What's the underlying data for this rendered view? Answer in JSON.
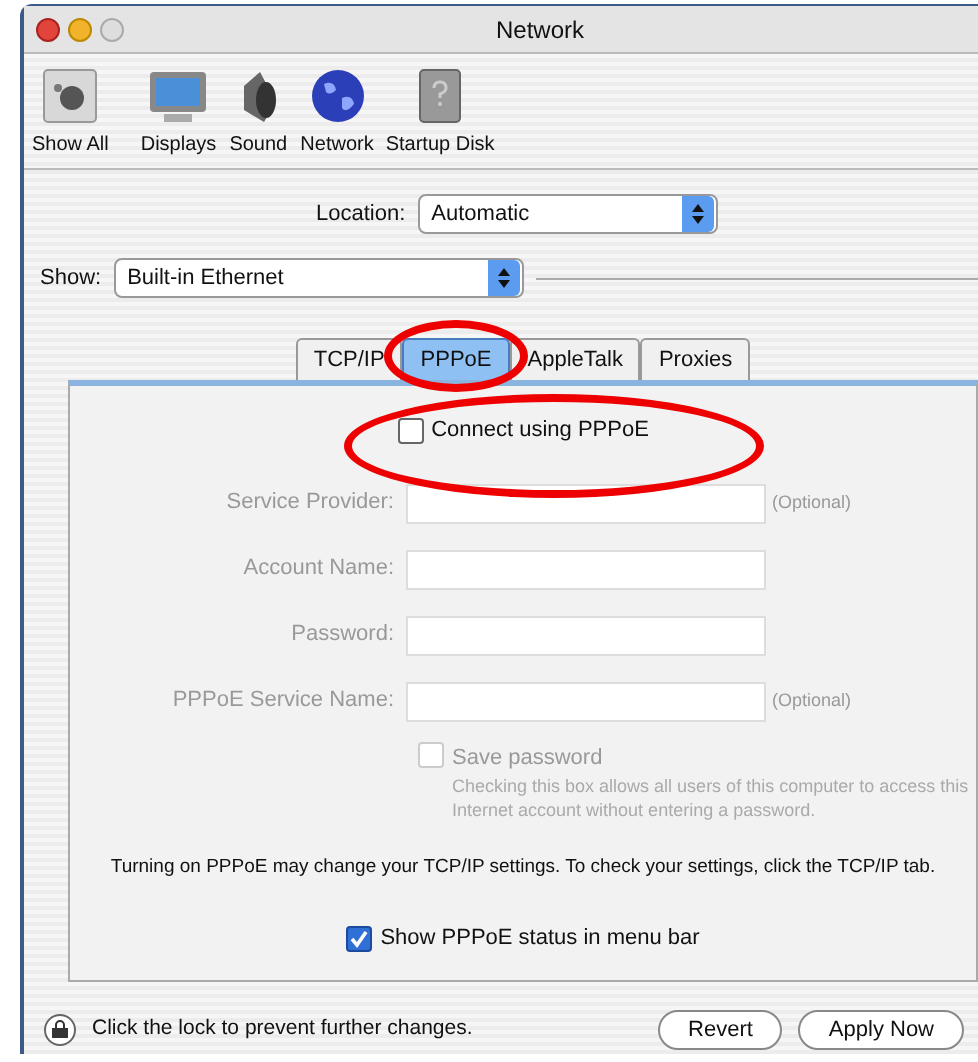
{
  "window": {
    "title": "Network"
  },
  "toolbar": [
    {
      "label": "Show All",
      "kind": "apple"
    },
    {
      "label": "Displays",
      "kind": "display"
    },
    {
      "label": "Sound",
      "kind": "speaker"
    },
    {
      "label": "Network",
      "kind": "globe"
    },
    {
      "label": "Startup Disk",
      "kind": "disk"
    }
  ],
  "location": {
    "label": "Location:",
    "value": "Automatic"
  },
  "show": {
    "label": "Show:",
    "value": "Built-in Ethernet"
  },
  "tabs": [
    {
      "label": "TCP/IP",
      "selected": false
    },
    {
      "label": "PPPoE",
      "selected": true
    },
    {
      "label": "AppleTalk",
      "selected": false
    },
    {
      "label": "Proxies",
      "selected": false
    }
  ],
  "connect": {
    "label": "Connect using PPPoE",
    "checked": false
  },
  "fields": [
    {
      "label": "Service Provider:",
      "note": "(Optional)",
      "disabled": true
    },
    {
      "label": "Account Name:",
      "disabled": true
    },
    {
      "label": "Password:",
      "disabled": true
    },
    {
      "label": "PPPoE Service Name:",
      "note": "(Optional)",
      "disabled": true
    }
  ],
  "save_password": {
    "label": "Save password",
    "checked": false,
    "disabled": true,
    "note": "Checking this box allows all users of this computer to access this Internet account without entering a password."
  },
  "notice": "Turning on PPPoE may change your TCP/IP settings. To check your settings, click the TCP/IP tab.",
  "show_status": {
    "label": "Show PPPoE status in menu bar",
    "checked": true
  },
  "footer": {
    "lock_text": "Click the lock to prevent further changes.",
    "buttons": [
      "Revert",
      "Apply Now"
    ]
  }
}
